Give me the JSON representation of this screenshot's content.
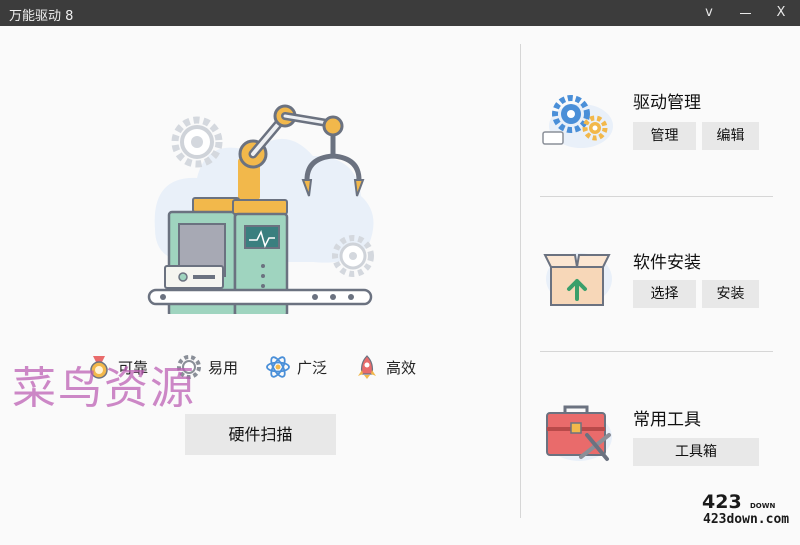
{
  "window": {
    "title": "万能驱动 8",
    "controls": {
      "menu": "v",
      "close": "X"
    }
  },
  "features": [
    {
      "label": "可靠",
      "icon": "medal-icon"
    },
    {
      "label": "易用",
      "icon": "gear-icon"
    },
    {
      "label": "广泛",
      "icon": "atom-icon"
    },
    {
      "label": "高效",
      "icon": "rocket-icon"
    }
  ],
  "scan_button": "硬件扫描",
  "sections": {
    "driver": {
      "title": "驱动管理",
      "buttons": [
        "管理",
        "编辑"
      ]
    },
    "software": {
      "title": "软件安装",
      "buttons": [
        "选择",
        "安装"
      ]
    },
    "tools": {
      "title": "常用工具",
      "buttons": [
        "工具箱"
      ]
    }
  },
  "watermarks": {
    "chinese": "菜鸟资源",
    "logo": "423",
    "logo_small": "DOWN",
    "url": "423down.com"
  },
  "colors": {
    "titlebar": "#3c3c3c",
    "background": "#fafafa",
    "button": "#e8e8e8",
    "gold": "#f2b84b",
    "teal": "#9fd4bf",
    "blue": "#4a8fd8",
    "red": "#e96b6b"
  }
}
